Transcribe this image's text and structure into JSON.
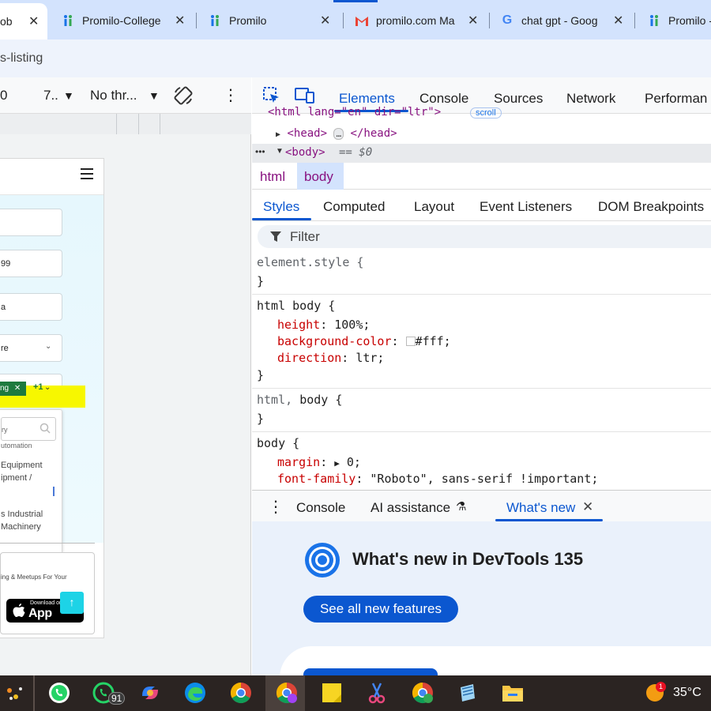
{
  "browser": {
    "tabs": [
      {
        "title": "ob",
        "close": "✕",
        "active": true
      },
      {
        "title": "Promilo-College",
        "close": "✕"
      },
      {
        "title": "Promilo",
        "close": "✕"
      },
      {
        "title": "promilo.com Ma",
        "close": "✕"
      },
      {
        "title": "chat gpt - Goog",
        "close": "✕"
      },
      {
        "title": "Promilo -",
        "close": ""
      }
    ],
    "address_text": "s-listing"
  },
  "device_toolbar": {
    "width_value": "0",
    "zoom_value": "7..",
    "throttle_value": "No thr...",
    "more": "⋮"
  },
  "mobile_page": {
    "fields": [
      "",
      "99",
      "a",
      "re"
    ],
    "chip_label": "ng",
    "chip_more": "+1",
    "dropdown_search": "ry",
    "dropdown_items": [
      {
        "line1": "utomation",
        "line2": ""
      },
      {
        "line1": "Equipment",
        "line2": "ipment /"
      },
      {
        "line1": "s Industrial",
        "line2": "Machinery"
      }
    ],
    "footer_text": "ing & Meetups For Your",
    "appstore_small": "Download on",
    "appstore_big": "App Store",
    "scroll_top_icon": "↑"
  },
  "devtools": {
    "tabs": [
      "Elements",
      "Console",
      "Sources",
      "Network",
      "Performan"
    ],
    "active_tab": "Elements",
    "dom": {
      "html_line": "<html lang=\"en\" dir=\"ltr\">",
      "html_badge": "scroll",
      "head_open": "<head>",
      "head_ellipsis": "…",
      "head_close": "</head>",
      "body_tag": "<body>",
      "body_eq": "== $0",
      "row_dots": "•••"
    },
    "breadcrumbs": [
      "html",
      "body"
    ],
    "styles_tabs": [
      "Styles",
      "Computed",
      "Layout",
      "Event Listeners",
      "DOM Breakpoints"
    ],
    "active_styles_tab": "Styles",
    "filter_placeholder": "Filter",
    "rules": {
      "r1_sel": "element.style {",
      "r1_close": "}",
      "r2_sel": "html body {",
      "r2_p1_name": "height",
      "r2_p1_val": "100%;",
      "r2_p2_name": "background-color",
      "r2_p2_val": "#fff;",
      "r2_p3_name": "direction",
      "r2_p3_val": "ltr;",
      "r2_close": "}",
      "r3_sel_a": "html,",
      "r3_sel_b": "body {",
      "r3_close": "}",
      "r4_sel": "body {",
      "r4_p1_name": "margin",
      "r4_p1_val": "0;",
      "r4_p2_name": "font-family",
      "r4_p2_val": "\"Roboto\", sans-serif !important;"
    },
    "drawer": {
      "tabs": [
        "Console",
        "AI assistance",
        "What's new"
      ],
      "active": "What's new",
      "close": "✕",
      "flask_icon": "⚗"
    },
    "whats_new": {
      "title": "What's new in DevTools 135",
      "button": "See all new features"
    }
  },
  "taskbar": {
    "whatsapp_badge": "91",
    "weather_temp": "35°C",
    "weather_badge": "1"
  },
  "colors": {
    "tab_strip": "#d3e3fd",
    "accent_blue": "#0b57d0",
    "highlight_yellow": "#f7f700",
    "chip_green": "#1e7a3e",
    "taskbar": "#2b2422"
  }
}
